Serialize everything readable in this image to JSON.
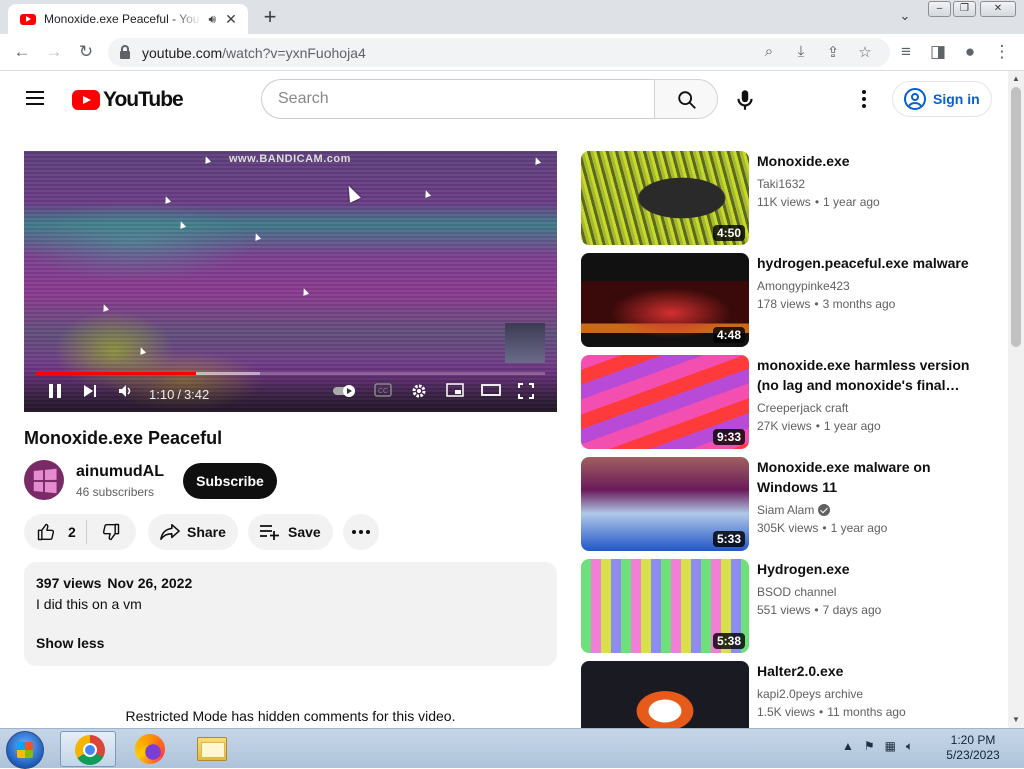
{
  "browser": {
    "tab_title": "Monoxide.exe Peaceful - YouTube",
    "url_host": "youtube.com",
    "url_rest": "/watch?v=yxnFuohoja4"
  },
  "youtube": {
    "logo_text": "YouTube",
    "search_placeholder": "Search",
    "sign_in": "Sign in"
  },
  "player": {
    "watermark": "www.BANDICAM.com",
    "current_time": "1:10",
    "duration": "3:42",
    "progress_fraction": 0.315,
    "buffered_fraction": 0.44
  },
  "video": {
    "title": "Monoxide.exe Peaceful",
    "channel": "ainumudAL",
    "subscribers": "46 subscribers",
    "subscribe_label": "Subscribe",
    "likes": "2",
    "share_label": "Share",
    "save_label": "Save",
    "views": "397 views",
    "date": "Nov 26, 2022",
    "description": "I did this on a vm",
    "show_less": "Show less",
    "restricted_notice": "Restricted Mode has hidden comments for this video."
  },
  "recommendations": [
    {
      "title": "Monoxide.exe",
      "channel": "Taki1632",
      "views": "11K views",
      "age": "1 year ago",
      "duration": "4:50",
      "verified": false
    },
    {
      "title": "hydrogen.peaceful.exe malware",
      "channel": "Amongypinke423",
      "views": "178 views",
      "age": "3 months ago",
      "duration": "4:48",
      "verified": false
    },
    {
      "title": "monoxide.exe harmless version (no lag and monoxide's final…",
      "channel": "Creeperjack craft",
      "views": "27K views",
      "age": "1 year ago",
      "duration": "9:33",
      "verified": false
    },
    {
      "title": "Monoxide.exe malware on Windows 11",
      "channel": "Siam Alam",
      "views": "305K views",
      "age": "1 year ago",
      "duration": "5:33",
      "verified": true
    },
    {
      "title": "Hydrogen.exe",
      "channel": "BSOD channel",
      "views": "551 views",
      "age": "7 days ago",
      "duration": "5:38",
      "verified": false
    },
    {
      "title": "Halter2.0.exe",
      "channel": "kapi2.0peys archive",
      "views": "1.5K views",
      "age": "11 months ago",
      "duration": "",
      "verified": false
    }
  ],
  "taskbar": {
    "time": "1:20 PM",
    "date": "5/23/2023"
  }
}
